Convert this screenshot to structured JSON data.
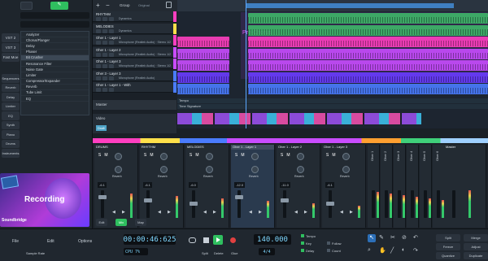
{
  "left": {
    "fx_list": [
      "Analyzer",
      "Chorus/Flanger",
      "Delay",
      "Phaser",
      "Bit Crusher",
      "Resonance Filter",
      "Noise Gate",
      "Limiter",
      "Compressor/Expander",
      "Reverb",
      "Tube Limit",
      "EQ"
    ],
    "fx_selected": 4,
    "side_tabs": [
      "VST 2",
      "VST 3",
      "Fast Moe"
    ],
    "inst_labels": [
      "Sequencers",
      "Reverb",
      "Delay",
      "Limiter",
      "EQ",
      "Synth",
      "Piano",
      "Drums",
      "Instruments"
    ],
    "promo_text": "Recording",
    "brand": "Soundbridge"
  },
  "tracks": [
    {
      "name": "RHYTHM",
      "sub": "Dynamics",
      "color": "#ff3fc0"
    },
    {
      "name": "MELODIES",
      "sub": "Dynamics",
      "color": "#ffe04a"
    },
    {
      "name": "Oher 1 - Layer 1",
      "sub": "Microphone (Realtek Audio) · Stereo 1/2",
      "color": "#ff3fc0"
    },
    {
      "name": "Oher 1 - Layer 2",
      "sub": "Microphone (Realtek Audio) · Stereo 1/2",
      "color": "#c94cff"
    },
    {
      "name": "Oher 1 - Layer 3",
      "sub": "Microphone (Realtek Audio) · Stereo 1/2",
      "color": "#c94cff"
    },
    {
      "name": "Oher 3 - Layer 3",
      "sub": "Microphone (Realtek Audio)",
      "color": "#4a7cff"
    },
    {
      "name": "Oher 1 - Layer 1 - With",
      "sub": "",
      "color": "#4a7cff"
    }
  ],
  "header": {
    "group_label": "Group",
    "deck_label": "Original"
  },
  "master": {
    "label": "Master"
  },
  "video": {
    "label": "Video",
    "sub": "Draft"
  },
  "arrange": {
    "marker": "Pre-Chorus",
    "tempo_lane": "Tempo",
    "sig_lane": "Time Signature"
  },
  "mixer": {
    "channels": [
      {
        "name": "DRUMS",
        "color": "#ff3fc0",
        "val": "-6.1"
      },
      {
        "name": "RHYTHM",
        "color": "#ffe04a",
        "val": "-6.1"
      },
      {
        "name": "MELODIES",
        "color": "#4a7cff",
        "val": "-6.0"
      },
      {
        "name": "Oher 1 - Layer 1",
        "color": "#c94cff",
        "val": "-12.0"
      },
      {
        "name": "Oher 1 - Layer 2",
        "color": "#c94cff",
        "val": "-11.0"
      },
      {
        "name": "Oher 1 - Layer 3",
        "color": "#c94cff",
        "val": "-6.1"
      }
    ],
    "narrow": [
      "Oher 1",
      "Oher 2",
      "Oher 3",
      "Oher 4",
      "Oher 5",
      "Oher 6"
    ],
    "master_name": "Master",
    "knob_label": "Reverb",
    "bottom": [
      "Edit",
      "Mix",
      "Map"
    ]
  },
  "transport": {
    "menu": [
      "File",
      "Edit",
      "Options"
    ],
    "sample_rate": "Sample Rate",
    "time": "00:00:46:625",
    "bpm": "140.000",
    "sig": "4/4",
    "cpu": "CPU 7%",
    "btns": [
      "Tempo",
      "Loop",
      "Metro",
      "Follow",
      "Count",
      "Split",
      "Delete",
      "Glue",
      "Adjust",
      "Quantize",
      "Merge",
      "Freeze",
      "Duplicate"
    ],
    "tool_labels": [
      "Tempo",
      "Key",
      "Delay",
      "Follow",
      "Count"
    ],
    "right_labels": [
      "Split",
      "Merge",
      "Freeze",
      "Adjust",
      "Quantize",
      "Duplicate"
    ]
  }
}
